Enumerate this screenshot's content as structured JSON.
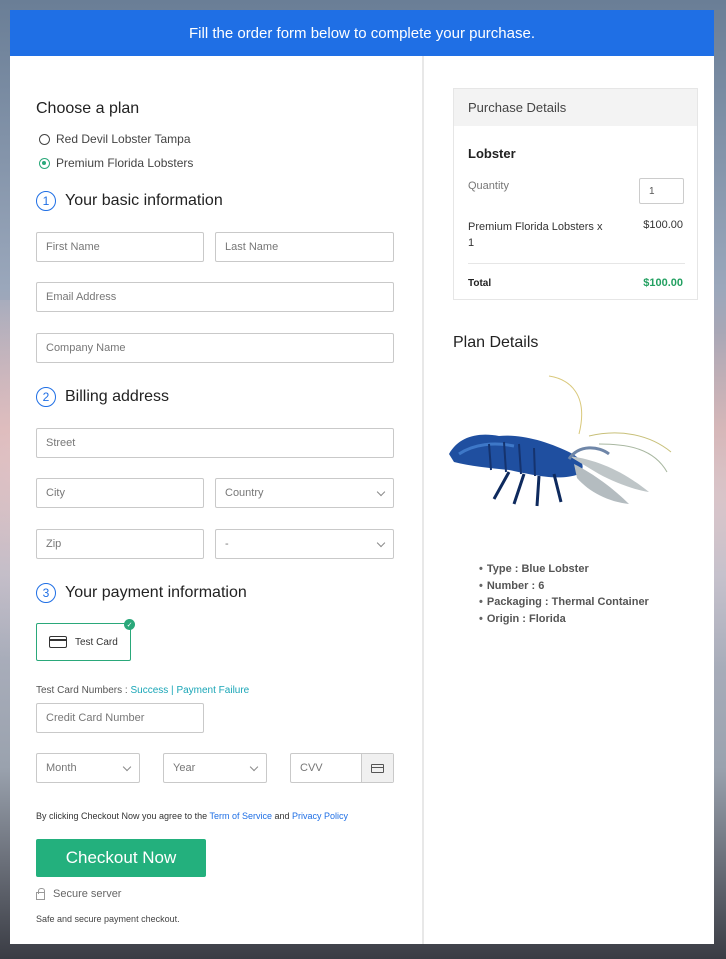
{
  "banner": {
    "text": "Fill the order form below to complete your purchase."
  },
  "plan": {
    "title": "Choose a plan",
    "options": [
      {
        "label": "Red Devil Lobster Tampa",
        "checked": false
      },
      {
        "label": "Premium Florida Lobsters",
        "checked": true
      }
    ]
  },
  "steps": {
    "basic": {
      "num": "1",
      "label": "Your basic information"
    },
    "billing": {
      "num": "2",
      "label": "Billing address"
    },
    "payment": {
      "num": "3",
      "label": "Your payment information"
    }
  },
  "fields": {
    "first_name": "First Name",
    "last_name": "Last Name",
    "email": "Email Address",
    "company": "Company Name",
    "street": "Street",
    "city": "City",
    "country": "Country",
    "zip": "Zip",
    "state": "-",
    "card_number": "Credit Card Number",
    "month": "Month",
    "year": "Year",
    "cvv": "CVV"
  },
  "payment": {
    "card_option": "Test Card",
    "test_numbers_label": "Test Card Numbers : ",
    "success_link": "Success",
    "separator": " | ",
    "failure_link": "Payment Failure"
  },
  "agreement": {
    "prefix": "By clicking Checkout Now you agree to the ",
    "terms": "Term of Service",
    "and": " and ",
    "privacy": "Privacy Policy"
  },
  "checkout": {
    "label": "Checkout Now"
  },
  "secure": {
    "label": "Secure server",
    "note": "Safe and secure payment checkout."
  },
  "purchase": {
    "header": "Purchase Details",
    "product": "Lobster",
    "qty_label": "Quantity",
    "qty_value": "1",
    "item_name": "Premium Florida Lobsters x 1",
    "item_price": "$100.00",
    "total_label": "Total",
    "total_value": "$100.00",
    "total_color": "#23a061"
  },
  "plan_details": {
    "title": "Plan Details",
    "specs": [
      "Type : Blue Lobster",
      "Number : 6",
      "Packaging : Thermal Container",
      "Origin : Florida"
    ]
  },
  "colors": {
    "brand_blue": "#1f6fe5",
    "checkout_green": "#23b07d",
    "link_teal": "#1aa6b7"
  }
}
